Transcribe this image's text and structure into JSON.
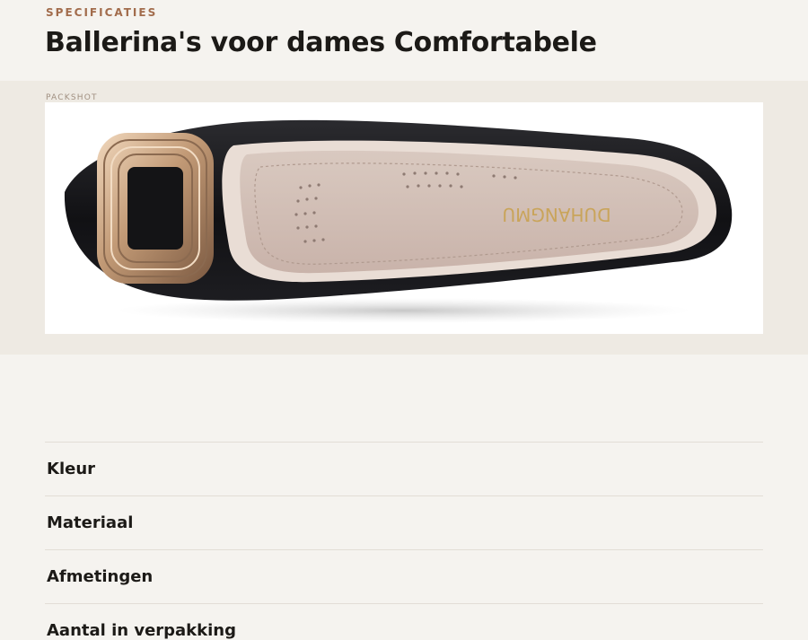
{
  "header": {
    "eyebrow": "SPECIFICATIES",
    "title": "Ballerina's voor dames Comfortabele"
  },
  "packshot": {
    "label": "PACKSHOT",
    "image_icon": "ballerina-shoe-image",
    "insole_brand": "DUHANGMU"
  },
  "specs": {
    "rows": [
      {
        "label": "Kleur"
      },
      {
        "label": "Materiaal"
      },
      {
        "label": "Afmetingen"
      },
      {
        "label": "Aantal in verpakking"
      }
    ]
  },
  "colors": {
    "background": "#f5f3ef",
    "band": "#eeeae3",
    "accent": "#a26c4c",
    "text": "#1c1a17",
    "divider": "#e2ddd6"
  }
}
